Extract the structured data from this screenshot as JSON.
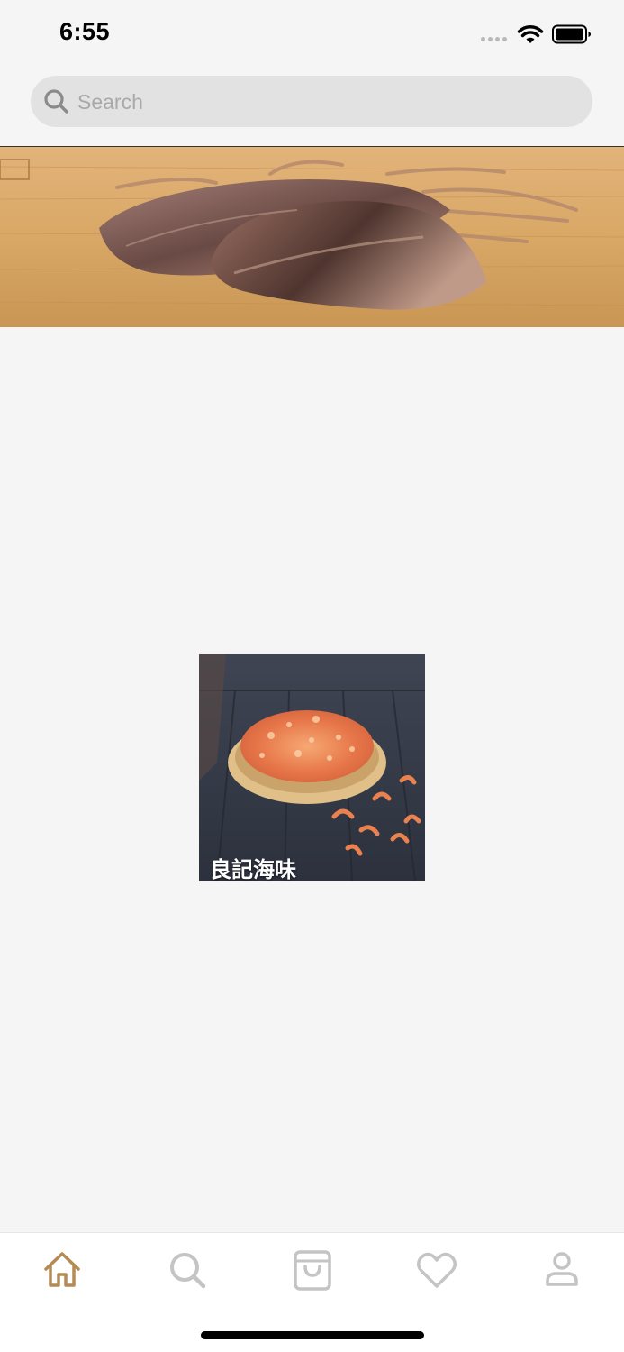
{
  "status_bar": {
    "time": "6:55",
    "signal_icon": "cellular-signal-icon",
    "wifi_icon": "wifi-icon",
    "battery_icon": "battery-icon"
  },
  "search": {
    "placeholder": "Search",
    "value": "",
    "icon": "search-icon"
  },
  "banner": {
    "image": "dried-squid-on-cutting-board"
  },
  "products": [
    {
      "title": "良記海味",
      "image": "dried-shrimp-in-bamboo-basket"
    }
  ],
  "tab_bar": {
    "active_color": "#b48a55",
    "inactive_color": "#c4c4c4",
    "tabs": [
      {
        "icon": "home-icon",
        "active": true
      },
      {
        "icon": "search-icon",
        "active": false
      },
      {
        "icon": "shopping-bag-icon",
        "active": false
      },
      {
        "icon": "heart-icon",
        "active": false
      },
      {
        "icon": "profile-icon",
        "active": false
      }
    ]
  }
}
